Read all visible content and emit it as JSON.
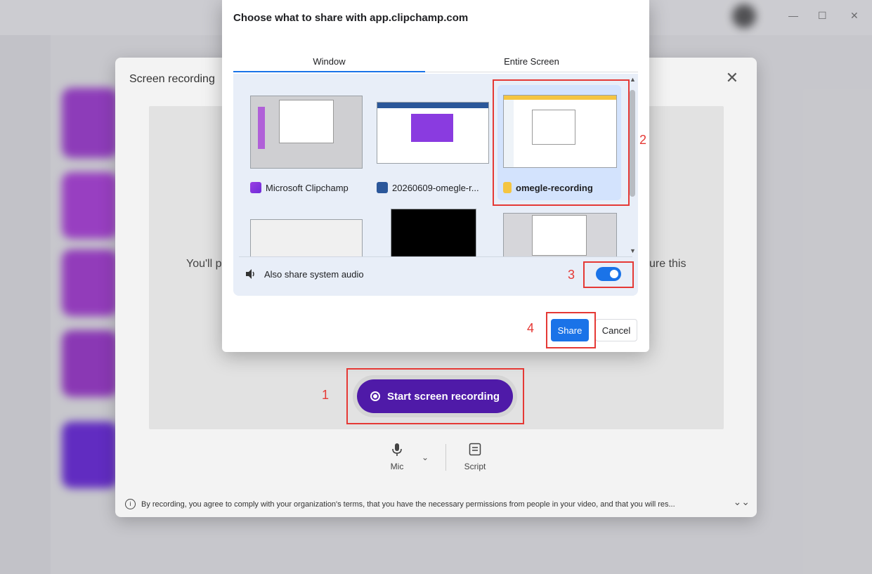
{
  "share_dialog": {
    "title": "Choose what to share with app.clipchamp.com",
    "tabs": [
      {
        "label": "Window",
        "active": true
      },
      {
        "label": "Entire Screen",
        "active": false
      }
    ],
    "windows": [
      {
        "label": "Microsoft Clipchamp",
        "icon": "clipchamp-icon",
        "selected": false
      },
      {
        "label": "20260609-omegle-r...",
        "icon": "word-icon",
        "selected": false
      },
      {
        "label": "omegle-recording",
        "icon": "folder-icon",
        "selected": true
      },
      {
        "label": "",
        "icon": "",
        "selected": false
      },
      {
        "label": "",
        "icon": "",
        "selected": false
      },
      {
        "label": "",
        "icon": "",
        "selected": false
      }
    ],
    "audio_label": "Also share system audio",
    "audio_enabled": true,
    "share_label": "Share",
    "cancel_label": "Cancel"
  },
  "recording_modal": {
    "title": "Screen recording",
    "body_text_left": "You'll p",
    "body_text_right": "ure this",
    "start_button_label": "Start screen recording",
    "mic_label": "Mic",
    "script_label": "Script",
    "footer_text": "By recording, you agree to comply with your organization's terms, that you have the necessary permissions from people in your video, and that you will res..."
  },
  "annotations": [
    "1",
    "2",
    "3",
    "4"
  ],
  "colors": {
    "accent": "#1a73e8",
    "record_button": "#4f1aa8",
    "annotation": "#e53935"
  }
}
